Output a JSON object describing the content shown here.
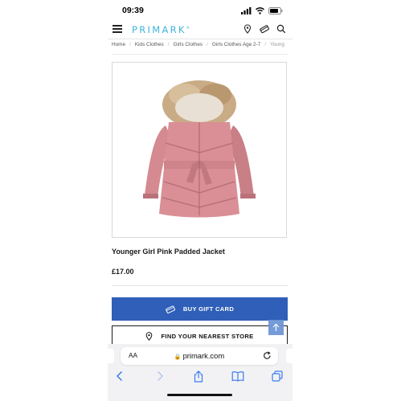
{
  "status_bar": {
    "time": "09:39"
  },
  "header": {
    "logo": "PRIMARK",
    "logo_mark": "®"
  },
  "breadcrumb": [
    "Home",
    "Kids Clothes",
    "Girls Clothes",
    "Girls Clothes Age 2-7",
    "Young"
  ],
  "product": {
    "title": "Younger Girl Pink Padded Jacket",
    "price": "£17.00",
    "image_alt": "pink padded jacket with fur hood"
  },
  "buttons": {
    "gift_card": "BUY GIFT CARD",
    "store_finder": "FIND YOUR NEAREST STORE"
  },
  "browser": {
    "text_size_label": "AA",
    "url": "primark.com"
  },
  "colors": {
    "brand": "#40b4d8",
    "gift_button": "#2f5fb8",
    "jacket": "#d98f95"
  }
}
